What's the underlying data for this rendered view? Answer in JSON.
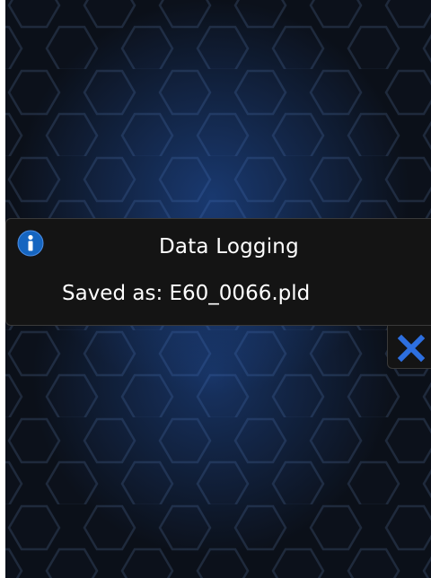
{
  "notification": {
    "icon": "info-icon",
    "title": "Data Logging",
    "message": "Saved as: E60_0066.pld",
    "close_icon": "close-icon"
  },
  "colors": {
    "panel_background": "#141414",
    "panel_border": "#3a3a3a",
    "text": "#ffffff",
    "accent_blue": "#1e5bd6",
    "info_icon_blue": "#1565c0"
  }
}
